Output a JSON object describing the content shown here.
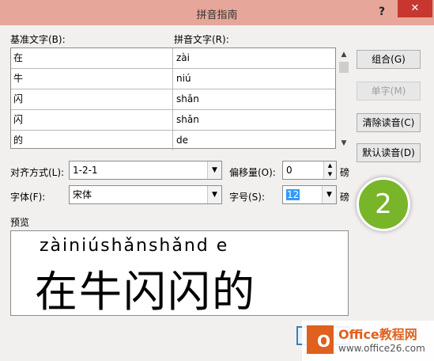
{
  "window": {
    "title": "拼音指南",
    "help": "?",
    "close": "✕"
  },
  "labels": {
    "base_text": "基准文字(B):",
    "ruby_text": "拼音文字(R):",
    "alignment": "对齐方式(L):",
    "offset": "偏移量(O):",
    "font": "字体(F):",
    "size": "字号(S):",
    "offset_unit": "磅",
    "size_unit": "磅",
    "preview": "预览"
  },
  "rows": [
    {
      "base": "在",
      "ruby": "zài"
    },
    {
      "base": "牛",
      "ruby": "niú"
    },
    {
      "base": "闪",
      "ruby": "shǎn"
    },
    {
      "base": "闪",
      "ruby": "shǎn"
    },
    {
      "base": "的",
      "ruby": "de"
    }
  ],
  "buttons": {
    "group": "组合(G)",
    "single": "单字(M)",
    "clear": "清除读音(C)",
    "default": "默认读音(D)"
  },
  "controls": {
    "alignment_value": "1-2-1",
    "offset_value": "0",
    "font_value": "宋体",
    "size_value": "12"
  },
  "preview": {
    "pinyin": "zàiniúshǎnshǎnd e",
    "hanzi": "在牛闪闪的"
  },
  "badge": "2",
  "watermark": {
    "brand": "Office教程网",
    "url": "www.office26.com"
  }
}
